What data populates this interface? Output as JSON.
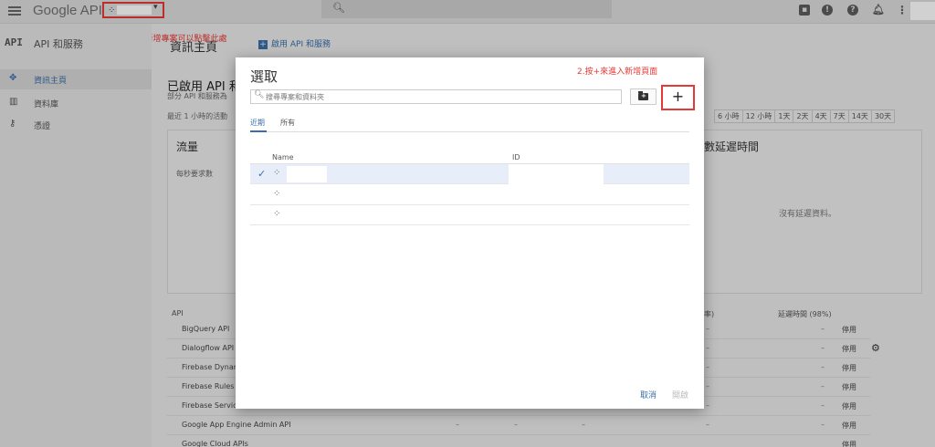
{
  "topbar": {
    "brand": "Google APIs",
    "project_caret": "▾",
    "icons": [
      "menu-icon",
      "gift-icon",
      "notifications-icon",
      "help-icon",
      "bell-icon",
      "more-vert-icon"
    ]
  },
  "annotations": {
    "step1": "1. 如果要新增專案可以點擊此處",
    "step2": "2.按+來進入新增頁面"
  },
  "sidebar": {
    "logo": "API",
    "title": "API 和服務",
    "items": [
      {
        "label": "資訊主頁",
        "icon": "dashboard-icon",
        "active": true
      },
      {
        "label": "資料庫",
        "icon": "library-icon",
        "active": false
      },
      {
        "label": "憑證",
        "icon": "key-icon",
        "active": false
      }
    ]
  },
  "main": {
    "page_title": "資訊主頁",
    "enable_label": "啟用 API 和服務",
    "enabled_title": "已啟用 API 和服",
    "enabled_sub": "部分 API 和服務為",
    "recent_label": "最近 1 小時的活動",
    "time_ranges": [
      "6 小時",
      "12 小時",
      "1天",
      "2天",
      "4天",
      "7天",
      "14天",
      "30天"
    ],
    "traffic_card": {
      "title": "流量",
      "sub": "每秒要求數"
    },
    "latency_card": {
      "title": "數延遲時間",
      "no_data": "沒有延遲資料。"
    },
    "table": {
      "col_api": "API",
      "col_errors_tail": "率)",
      "col_latency": "延遲時間 (98%)",
      "rows": [
        {
          "name": "BigQuery API",
          "d1": "",
          "d2": "",
          "d3": "",
          "d4": "–",
          "d5": "–",
          "action": "停用",
          "gear": false
        },
        {
          "name": "Dialogflow API",
          "d1": "",
          "d2": "",
          "d3": "",
          "d4": "–",
          "d5": "–",
          "action": "停用",
          "gear": true
        },
        {
          "name": "Firebase Dynam",
          "d1": "",
          "d2": "",
          "d3": "",
          "d4": "–",
          "d5": "–",
          "action": "停用",
          "gear": false
        },
        {
          "name": "Firebase Rules A",
          "d1": "",
          "d2": "",
          "d3": "",
          "d4": "–",
          "d5": "–",
          "action": "停用",
          "gear": false
        },
        {
          "name": "Firebase Service",
          "d1": "",
          "d2": "",
          "d3": "",
          "d4": "–",
          "d5": "–",
          "action": "停用",
          "gear": false
        },
        {
          "name": "Google App Engine Admin API",
          "d1": "–",
          "d2": "–",
          "d3": "–",
          "d4": "–",
          "d5": "–",
          "action": "停用",
          "gear": false
        },
        {
          "name": "Google Cloud APIs",
          "d1": "",
          "d2": "",
          "d3": "",
          "d4": "",
          "d5": "",
          "action": "停用",
          "gear": false
        }
      ]
    }
  },
  "modal": {
    "title": "選取",
    "search_placeholder": "搜尋專案和資料夾",
    "folder_button_icon": "new-folder-icon",
    "add_button": "+",
    "tabs": [
      {
        "label": "近期",
        "active": true
      },
      {
        "label": "所有",
        "active": false
      }
    ],
    "columns": {
      "name": "Name",
      "id": "ID"
    },
    "rows": [
      {
        "selected": true,
        "check": "✓"
      },
      {
        "selected": false,
        "check": ""
      },
      {
        "selected": false,
        "check": ""
      }
    ],
    "cancel": "取消",
    "open": "開啟"
  }
}
